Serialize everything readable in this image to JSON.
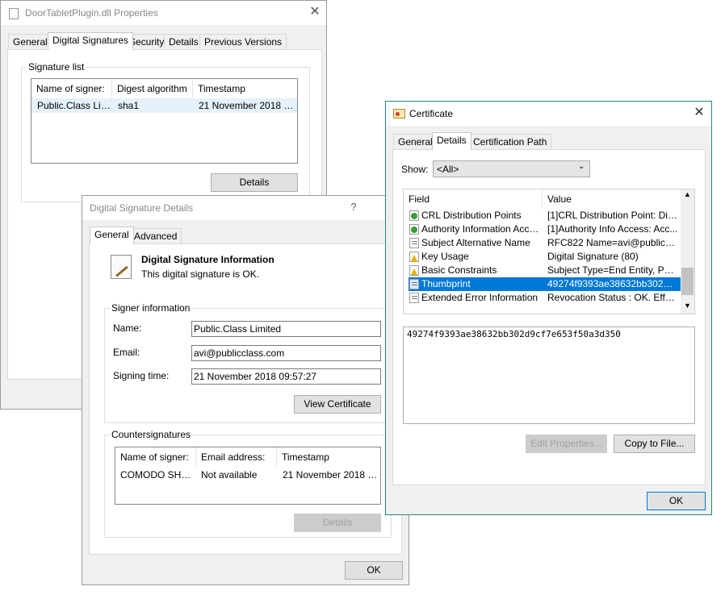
{
  "props": {
    "title": "DoorTabletPlugin.dll Properties",
    "tabs": [
      "General",
      "Digital Signatures",
      "Security",
      "Details",
      "Previous Versions"
    ],
    "sig_list_label": "Signature list",
    "columns": [
      "Name of signer:",
      "Digest algorithm",
      "Timestamp"
    ],
    "row": [
      "Public.Class Limit...",
      "sha1",
      "21 November 2018 0..."
    ],
    "details_button": "Details"
  },
  "sigdetails": {
    "title": "Digital Signature Details",
    "help": "?",
    "tabs": [
      "General",
      "Advanced"
    ],
    "info_title": "Digital Signature Information",
    "info_status": "This digital signature is OK.",
    "signer_group": "Signer information",
    "name_label": "Name:",
    "name_value": "Public.Class Limited",
    "email_label": "Email:",
    "email_value": "avi@publicclass.com",
    "time_label": "Signing time:",
    "time_value": "21 November  2018 09:57:27",
    "view_cert_button": "View Certificate",
    "counter_group": "Countersignatures",
    "counter_columns": [
      "Name of signer:",
      "Email address:",
      "Timestamp"
    ],
    "counter_row": [
      "COMODO SHA-1...",
      "Not available",
      "21 November 2018 0..."
    ],
    "counter_details_button": "Details",
    "ok_button": "OK"
  },
  "cert": {
    "title": "Certificate",
    "tabs": [
      "General",
      "Details",
      "Certification Path"
    ],
    "show_label": "Show:",
    "show_value": "<All>",
    "columns": [
      "Field",
      "Value"
    ],
    "rows": [
      {
        "field": "CRL Distribution Points",
        "value": "[1]CRL Distribution Point: Distr...",
        "icon": "download-arrow-icon"
      },
      {
        "field": "Authority Information Access",
        "value": "[1]Authority Info Access: Acc...",
        "icon": "download-arrow-icon"
      },
      {
        "field": "Subject Alternative Name",
        "value": "RFC822 Name=avi@publicclas...",
        "icon": "certificate-field-icon"
      },
      {
        "field": "Key Usage",
        "value": "Digital Signature (80)",
        "icon": "warning-icon"
      },
      {
        "field": "Basic Constraints",
        "value": "Subject Type=End Entity, Pat...",
        "icon": "warning-icon"
      },
      {
        "field": "Thumbprint",
        "value": "49274f9393ae38632bb302d9c...",
        "icon": "certificate-field-icon",
        "selected": true
      },
      {
        "field": "Extended Error Information",
        "value": "Revocation Status : OK. Effec...",
        "icon": "certificate-field-icon"
      }
    ],
    "detail_text": "49274f9393ae38632bb302d9cf7e653f50a3d350",
    "edit_button": "Edit Properties...",
    "copy_button": "Copy to File...",
    "ok_button": "OK"
  },
  "colors": {
    "selection": "#0078d7",
    "cert_border": "#1b8b7c"
  }
}
